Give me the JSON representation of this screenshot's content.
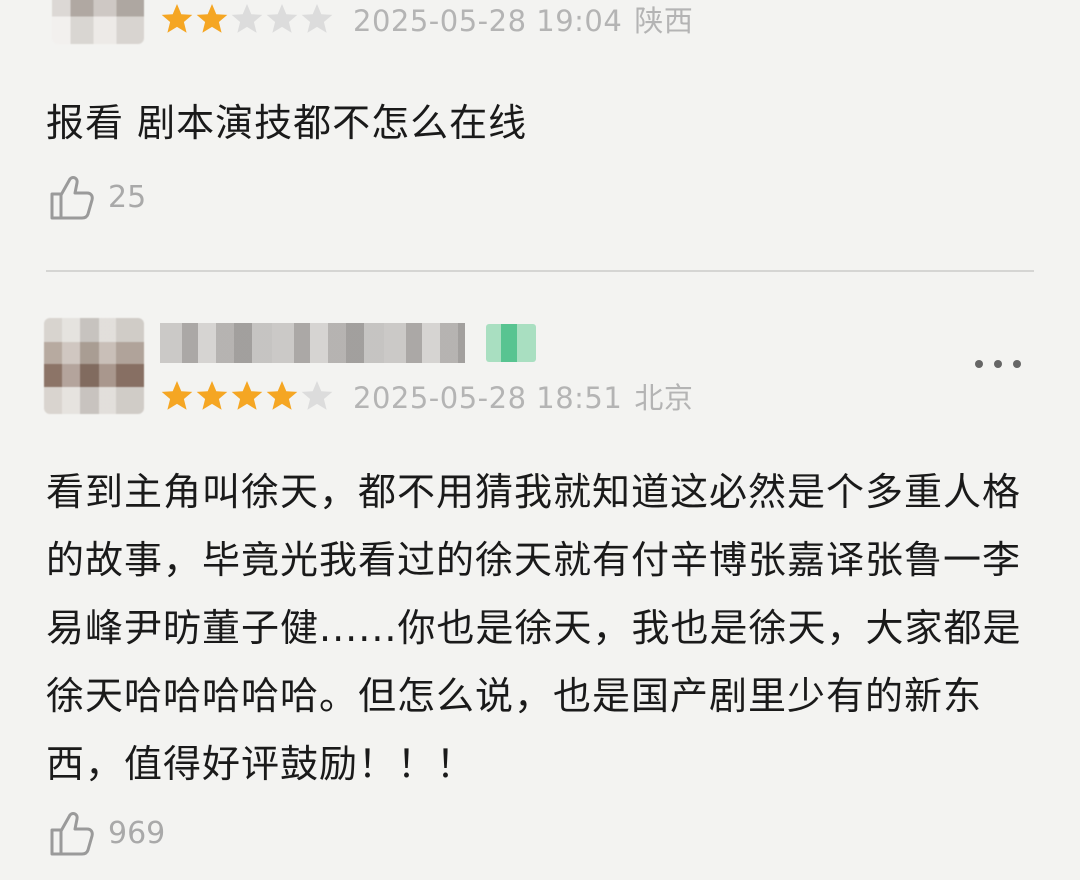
{
  "reviews": [
    {
      "rating": 2,
      "max_rating": 5,
      "date": "2025-05-28 19:04",
      "location": "陕西",
      "text": "报看 剧本演技都不怎么在线",
      "likes": "25"
    },
    {
      "rating": 4,
      "max_rating": 5,
      "date": "2025-05-28 18:51",
      "location": "北京",
      "text": "看到主角叫徐天，都不用猜我就知道这必然是个多重人格的故事，毕竟光我看过的徐天就有付辛博张嘉译张鲁一李易峰尹昉董子健......你也是徐天，我也是徐天，大家都是徐天哈哈哈哈哈。但怎么说，也是国产剧里少有的新东西，值得好评鼓励！！！",
      "likes": "969"
    }
  ],
  "colors": {
    "star_filled": "#f5a623",
    "star_empty": "#dcdcdc",
    "meta_text": "#b4b4b4",
    "like_text": "#a9a9a9"
  },
  "icons": {
    "like": "thumbs-up-icon",
    "more": "more-dots-icon",
    "star": "star-icon"
  }
}
